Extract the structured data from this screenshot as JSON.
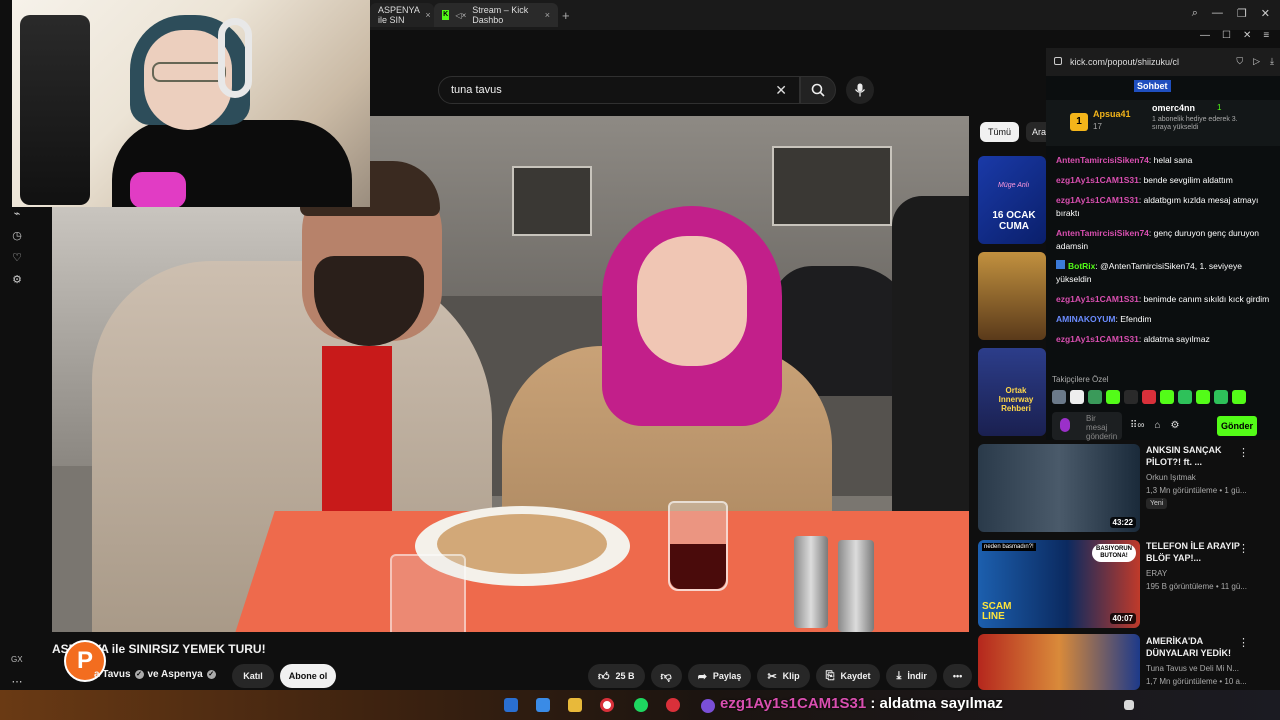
{
  "browser": {
    "tabs": [
      {
        "label": "ASPENYA ile SIN",
        "close": "×"
      },
      {
        "label": "Stream – Kick Dashbo",
        "close": "×"
      }
    ],
    "new_tab": "+"
  },
  "search": {
    "query": "tuna tavus"
  },
  "chips": {
    "all": "Tümü",
    "second": "Ara"
  },
  "video": {
    "title": "ASPENYA ile SINIRSIZ YEMEK TURU!",
    "title_visible": "AS      A ile SINIRSIZ YEMEK TURU!",
    "channel": "a Tavus",
    "collab": "ve Aspenya",
    "join_label": "Katıl",
    "subscribe_label": "Abone ol",
    "likes": "25 B",
    "share_label": "Paylaş",
    "clip_label": "Klip",
    "save_label": "Kaydet",
    "download_label": "İndir",
    "more": "•••"
  },
  "recommendations": [
    {
      "thumb_text": "16 OCAK CUMA",
      "thumb_top": "Müge Anlı"
    },
    {
      "thumb_text": ""
    },
    {
      "thumb_text": "Ortak Innerway Rehberi"
    },
    {
      "title": "ANKSIN SANÇAK PİLOT?! ft. ...",
      "channel": "Orkun Işıtmak",
      "meta": "1,3 Mn görüntüleme • 1 gü...",
      "badge": "Yeni",
      "duration": "43:22"
    },
    {
      "title": "TELEFON İLE ARAYIP BLÖF YAP!...",
      "channel": "ERAY",
      "meta": "195 B görüntüleme • 11 gü...",
      "duration": "40:07",
      "thumb_text": "SCAM LINE",
      "thumb_bubble": "BASIYORUN BUTONA!",
      "thumb_tag": "neden basmadın?!"
    },
    {
      "title": "AMERİKA'DA DÜNYALARI YEDİK!",
      "channel": "Tuna Tavus ve Deli Mi N...",
      "meta": "1,7 Mn görüntüleme • 10 a..."
    }
  ],
  "kick": {
    "url": "kick.com/popout/shiizuku/cl",
    "tab_label": "Sohbet",
    "pinned": {
      "badge": "1",
      "user": "Apsua41",
      "count": "17",
      "user2": "omerc4nn",
      "user2_count": "1",
      "desc": "1 abonelik hediye ederek 3. sıraya yükseldi"
    },
    "messages": [
      {
        "user": "AntenTamircisiSiken74",
        "color": "#d94fb0",
        "text": "helal sana"
      },
      {
        "user": "ezg1Ay1s1CAM1S31",
        "color": "#d94fb0",
        "text": "bende sevgilim aldattım"
      },
      {
        "user": "ezg1Ay1s1CAM1S31",
        "color": "#d94fb0",
        "text": "aldatbgım kızlda mesaj atmayı bıraktı"
      },
      {
        "user": "AntenTamircisiSiken74",
        "color": "#d94fb0",
        "text": "genç duruyon genç duruyon adamsin"
      },
      {
        "user": "BotRix",
        "color": "#53fc18",
        "text": "@AntenTamircisiSiken74, 1. seviyeye yükseldin"
      },
      {
        "user": "ezg1Ay1s1CAM1S31",
        "color": "#d94fb0",
        "text": "benimde canım sıkıldı kıck girdim"
      },
      {
        "user": "AMINAKOYUM",
        "color": "#6b8cff",
        "text": "Efendim"
      },
      {
        "user": "ezg1Ay1s1CAM1S31",
        "color": "#d94fb0",
        "text": "aldatma sayılmaz"
      }
    ],
    "followers_only": "Takipçilere Özel",
    "input_placeholder": "Bir mesaj gönderin",
    "send_label": "Gönder"
  },
  "overlay": {
    "user": "ezg1Ay1s1CAM1S31",
    "text": ": aldatma sayılmaz"
  },
  "sidebar": {
    "bottom_label": "GX"
  },
  "colors": {
    "kick_green": "#53fc18",
    "yt_bg": "#0f0f0f",
    "chat_pink": "#d94fb0"
  }
}
